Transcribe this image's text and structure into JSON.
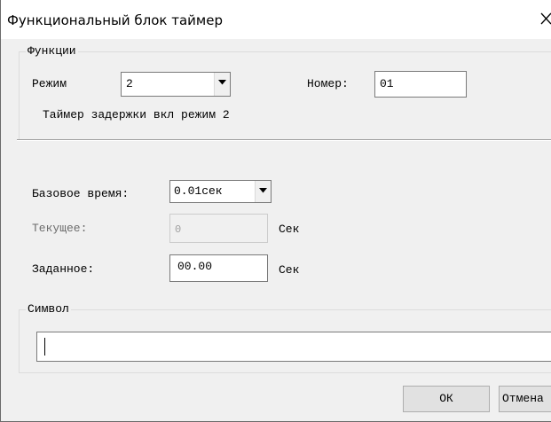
{
  "window": {
    "title": "Функциональный блок таймер"
  },
  "functions_group": {
    "legend": "Функции",
    "mode_label": "Режим",
    "mode_value": "2",
    "number_label": "Номер:",
    "number_value": "01",
    "description": "Таймер задержки вкл режим 2"
  },
  "timing": {
    "base_time_label": "Базовое время:",
    "base_time_value": "0.01сек",
    "current_label": "Текущее:",
    "current_value": "0",
    "current_unit": "Сек",
    "preset_label": "Заданное:",
    "preset_value": "00.00",
    "preset_unit": "Сек"
  },
  "symbol_group": {
    "legend": "Символ",
    "value": ""
  },
  "buttons": {
    "ok": "ОК",
    "cancel": "Отмена"
  },
  "icons": {
    "close": "close-icon",
    "dropdown": "chevron-down-icon"
  }
}
